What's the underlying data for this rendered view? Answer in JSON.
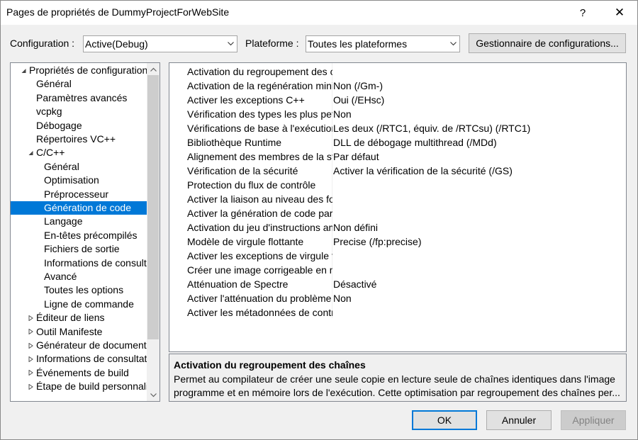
{
  "window": {
    "title": "Pages de propriétés de DummyProjectForWebSite",
    "help_glyph": "?",
    "close_glyph": "✕"
  },
  "toolbar": {
    "configuration_label": "Configuration :",
    "configuration_value": "Active(Debug)",
    "platform_label": "Plateforme :",
    "platform_value": "Toutes les plateformes",
    "config_manager_label": "Gestionnaire de configurations..."
  },
  "tree": {
    "items": [
      {
        "label": "Propriétés de configuration",
        "level": 0,
        "expander": "expanded"
      },
      {
        "label": "Général",
        "level": 1,
        "expander": ""
      },
      {
        "label": "Paramètres avancés",
        "level": 1,
        "expander": ""
      },
      {
        "label": "vcpkg",
        "level": 1,
        "expander": ""
      },
      {
        "label": "Débogage",
        "level": 1,
        "expander": ""
      },
      {
        "label": "Répertoires VC++",
        "level": 1,
        "expander": ""
      },
      {
        "label": "C/C++",
        "level": 1,
        "expander": "expanded"
      },
      {
        "label": "Général",
        "level": 2,
        "expander": ""
      },
      {
        "label": "Optimisation",
        "level": 2,
        "expander": ""
      },
      {
        "label": "Préprocesseur",
        "level": 2,
        "expander": ""
      },
      {
        "label": "Génération de code",
        "level": 2,
        "expander": "",
        "selected": true
      },
      {
        "label": "Langage",
        "level": 2,
        "expander": ""
      },
      {
        "label": "En-têtes précompilés",
        "level": 2,
        "expander": ""
      },
      {
        "label": "Fichiers de sortie",
        "level": 2,
        "expander": ""
      },
      {
        "label": "Informations de consultation",
        "level": 2,
        "expander": ""
      },
      {
        "label": "Avancé",
        "level": 2,
        "expander": ""
      },
      {
        "label": "Toutes les options",
        "level": 2,
        "expander": ""
      },
      {
        "label": "Ligne de commande",
        "level": 2,
        "expander": ""
      },
      {
        "label": "Éditeur de liens",
        "level": 1,
        "expander": "collapsed"
      },
      {
        "label": "Outil Manifeste",
        "level": 1,
        "expander": "collapsed"
      },
      {
        "label": "Générateur de document XML",
        "level": 1,
        "expander": "collapsed"
      },
      {
        "label": "Informations de consultation",
        "level": 1,
        "expander": "collapsed"
      },
      {
        "label": "Événements de build",
        "level": 1,
        "expander": "collapsed"
      },
      {
        "label": "Étape de build personnalisée",
        "level": 1,
        "expander": "collapsed"
      }
    ]
  },
  "grid": {
    "rows": [
      {
        "name": "Activation du regroupement des chaînes",
        "value": ""
      },
      {
        "name": "Activation de la regénération minimale",
        "value": "Non (/Gm-)"
      },
      {
        "name": "Activer les exceptions C++",
        "value": "Oui (/EHsc)"
      },
      {
        "name": "Vérification des types les plus petits",
        "value": "Non"
      },
      {
        "name": "Vérifications de base à l'exécution",
        "value": "Les deux (/RTC1, équiv. de /RTCsu) (/RTC1)"
      },
      {
        "name": "Bibliothèque Runtime",
        "value": "DLL de débogage multithread (/MDd)"
      },
      {
        "name": "Alignement des membres de la structure",
        "value": "Par défaut"
      },
      {
        "name": "Vérification de la sécurité",
        "value": "Activer la vérification de la sécurité (/GS)"
      },
      {
        "name": "Protection du flux de contrôle",
        "value": ""
      },
      {
        "name": "Activer la liaison au niveau des fonctions",
        "value": ""
      },
      {
        "name": "Activer la génération de code parallèle",
        "value": ""
      },
      {
        "name": "Activation du jeu d'instructions amélioré",
        "value": "Non défini"
      },
      {
        "name": "Modèle de virgule flottante",
        "value": "Precise (/fp:precise)"
      },
      {
        "name": "Activer les exceptions de virgule flottante",
        "value": ""
      },
      {
        "name": "Créer une image corrigeable en mémoire",
        "value": ""
      },
      {
        "name": "Atténuation de Spectre",
        "value": "Désactivé"
      },
      {
        "name": "Activer l'atténuation du problème",
        "value": "Non"
      },
      {
        "name": "Activer les métadonnées de contrôle",
        "value": ""
      }
    ]
  },
  "description": {
    "title": "Activation du regroupement des chaînes",
    "line1": "Permet au compilateur de créer une seule copie en lecture seule de chaînes identiques dans l'image",
    "line2": "programme et en mémoire lors de l'exécution. Cette optimisation par regroupement des chaînes per..."
  },
  "buttons": {
    "ok": "OK",
    "cancel": "Annuler",
    "apply": "Appliquer"
  },
  "colors": {
    "selection": "#0078d7",
    "default_button_border": "#0078d7"
  }
}
